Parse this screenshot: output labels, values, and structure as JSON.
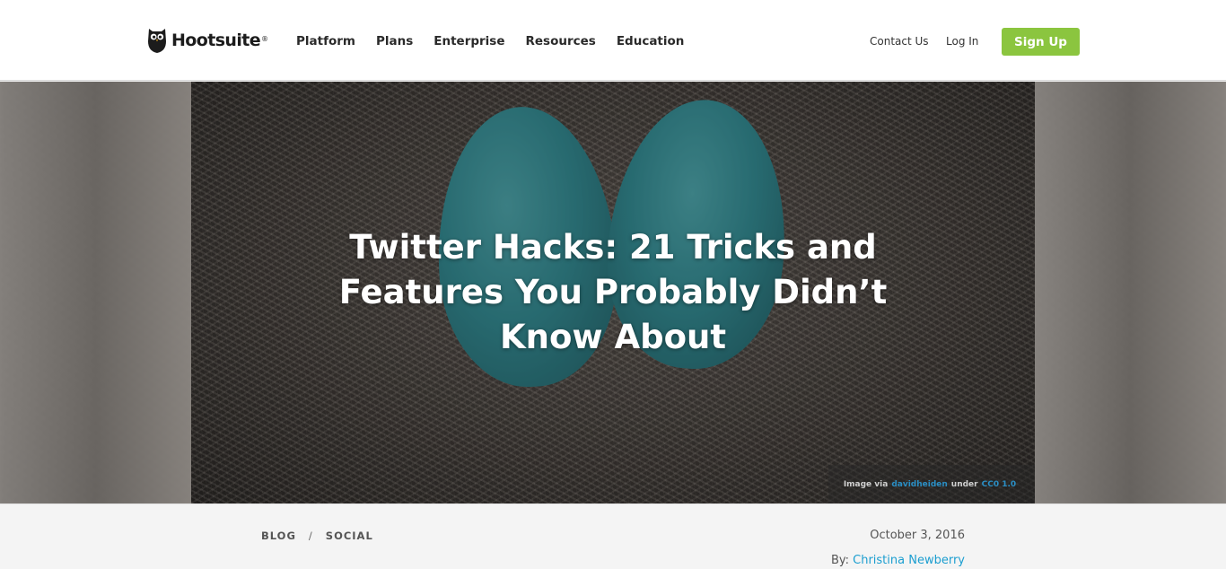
{
  "header": {
    "brand": "Hootsuite",
    "brand_mark": "®",
    "nav": [
      "Platform",
      "Plans",
      "Enterprise",
      "Resources",
      "Education"
    ],
    "contact_label": "Contact Us",
    "login_label": "Log In",
    "signup_label": "Sign Up",
    "signup_color": "#8bc53f"
  },
  "hero": {
    "title_line1": "Twitter Hacks: 21 Tricks and",
    "title_line2": "Features You Probably Didn’t",
    "title_line3": "Know About",
    "credit_prefix": "Image via",
    "credit_source": "davidheiden",
    "credit_middle": "under",
    "credit_license": "CC0 1.0"
  },
  "meta": {
    "crumb_blog": "BLOG",
    "crumb_sep": "/",
    "crumb_social": "SOCIAL",
    "date": "October 3, 2016",
    "by_label": "By:",
    "author": "Christina Newberry",
    "link_color": "#1b9ed0"
  },
  "icons": {
    "logo": "owl-logo-icon"
  }
}
